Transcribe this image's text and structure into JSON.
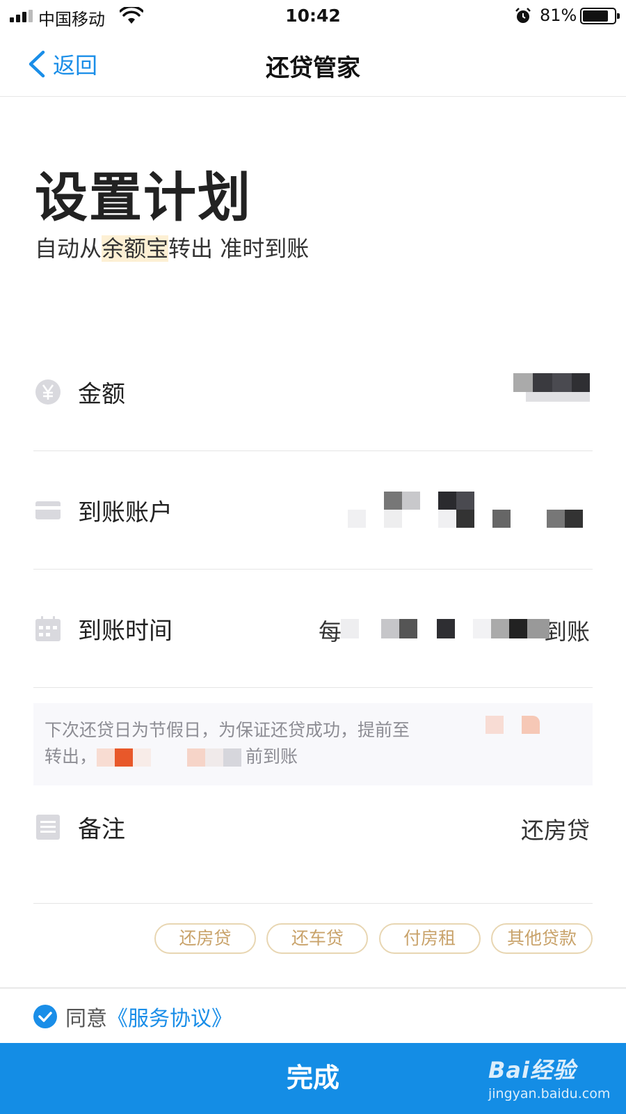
{
  "status_bar": {
    "carrier": "中国移动",
    "time": "10:42",
    "battery_text": "81%",
    "battery_level": 0.81,
    "icons": [
      "signal-icon",
      "wifi-icon",
      "alarm-icon",
      "battery-icon"
    ]
  },
  "nav": {
    "back_label": "返回",
    "title": "还贷管家"
  },
  "header": {
    "title": "设置计划",
    "subtitle_pre": "自动从",
    "subtitle_highlight": "余额宝",
    "subtitle_post": "转出 准时到账"
  },
  "rows": {
    "amount": {
      "label": "金额",
      "icon": "yen-icon"
    },
    "account": {
      "label": "到账账户",
      "icon": "card-icon"
    },
    "time": {
      "label": "到账时间",
      "icon": "calendar-icon",
      "value_pre": "每",
      "value_post": "到账"
    },
    "note": {
      "label": "备注",
      "icon": "note-icon",
      "value": "还房贷"
    }
  },
  "notice": {
    "line1": "下次还贷日为节假日，为保证还贷成功，提前至",
    "line2_pre": "转出，",
    "line2_post": "前到账"
  },
  "tags": [
    "还房贷",
    "还车贷",
    "付房租",
    "其他贷款"
  ],
  "agreement": {
    "checked": true,
    "text": "同意",
    "link": "《服务协议》"
  },
  "done_button": "完成",
  "watermark": {
    "main": "Bai经验",
    "sub": "jingyan.baidu.com"
  },
  "colors": {
    "accent": "#148de5",
    "tag_border": "#e8d6b2",
    "tag_text": "#c9a36b",
    "highlight": "#fdf0d4"
  }
}
